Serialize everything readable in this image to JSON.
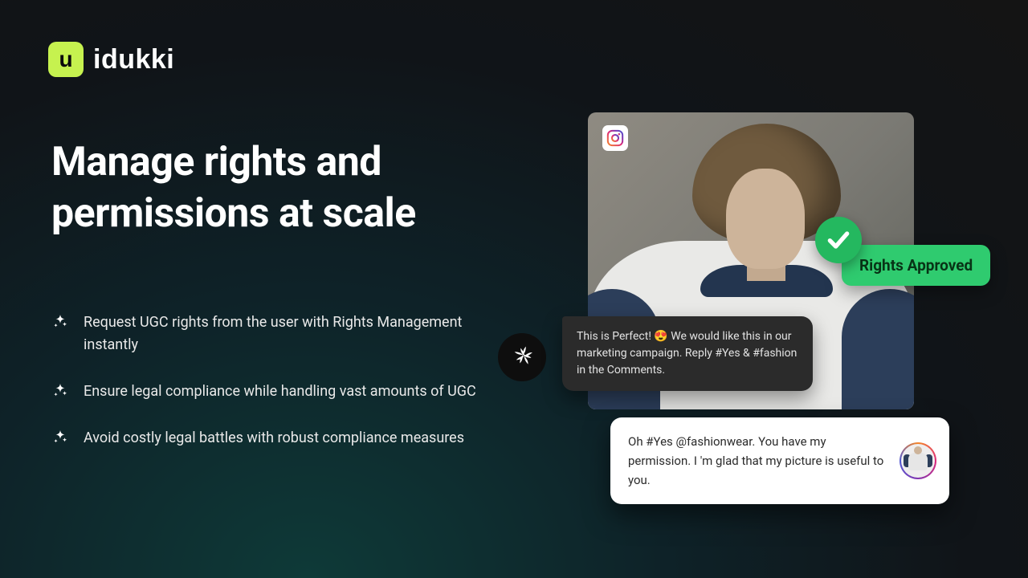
{
  "brand": {
    "name": "idukki",
    "mark": "u",
    "accent": "#c6f24f"
  },
  "hero": {
    "title": "Manage rights and permissions at scale",
    "bullets": [
      "Request UGC rights from the user with Rights Management instantly",
      "Ensure legal compliance while handling vast amounts of UGC",
      "Avoid costly legal battles with robust compliance measures"
    ]
  },
  "rights_badge": {
    "label": "Rights Approved",
    "color": "#2fcb6f"
  },
  "messages": {
    "brand": "This is Perfect! 😍 We would like this in our marketing campaign. Reply #Yes & #fashion in the Comments.",
    "user": "Oh #Yes @fashionwear. You have my permission. I 'm glad that my picture is useful to you."
  },
  "icons": {
    "source": "instagram-icon",
    "check": "check-icon",
    "brand_avatar": "pinwheel-icon",
    "sparkle": "sparkle-icon"
  }
}
